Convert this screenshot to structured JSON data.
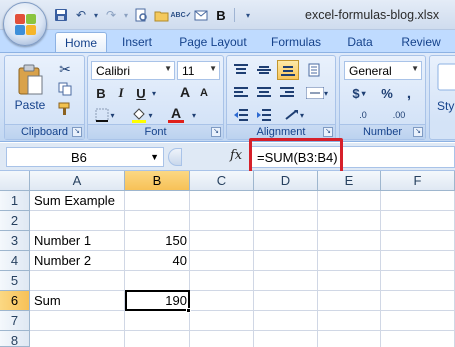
{
  "window": {
    "title": "excel-formulas-blog.xlsx"
  },
  "tabs": [
    "Home",
    "Insert",
    "Page Layout",
    "Formulas",
    "Data",
    "Review"
  ],
  "active_tab": "Home",
  "ribbon": {
    "clipboard": {
      "label": "Clipboard",
      "paste_label": "Paste"
    },
    "font": {
      "label": "Font",
      "font_name": "Calibri",
      "font_size": "11",
      "bold": "B",
      "italic": "I",
      "underline": "U",
      "grow": "A",
      "shrink": "A",
      "font_color": "A"
    },
    "alignment": {
      "label": "Alignment"
    },
    "number": {
      "label": "Number",
      "format": "General",
      "currency": "$",
      "percent": "%",
      "comma": ",",
      "dec_inc": ".0",
      "dec_dec": ".00"
    },
    "styles": {
      "label": "Styl"
    }
  },
  "formula_bar": {
    "name_box": "B6",
    "fx": "fx",
    "formula": "=SUM(B3:B4)"
  },
  "columns": [
    "A",
    "B",
    "C",
    "D",
    "E",
    "F"
  ],
  "selected_column": "B",
  "rows": [
    "1",
    "2",
    "3",
    "4",
    "5",
    "6",
    "7",
    "8"
  ],
  "selected_row": "6",
  "cells": {
    "A1": "Sum Example",
    "A3": "Number 1",
    "B3": "150",
    "A4": "Number 2",
    "B4": "40",
    "A6": "Sum",
    "B6": "190"
  }
}
